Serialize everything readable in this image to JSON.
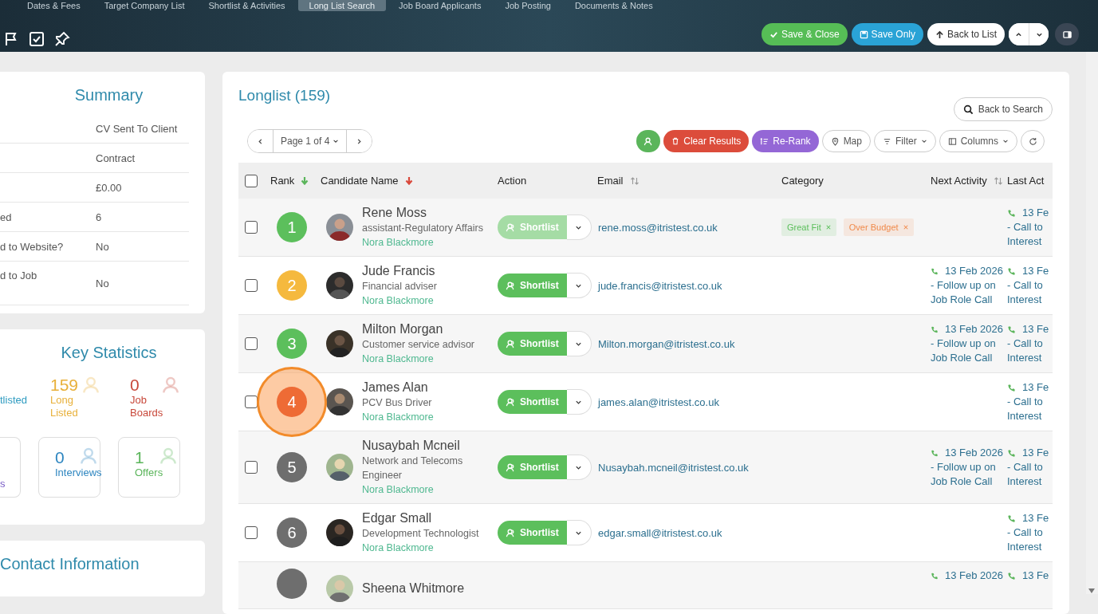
{
  "tabs": [
    {
      "label": "Dates & Fees",
      "selected": false
    },
    {
      "label": "Target Company List",
      "selected": false
    },
    {
      "label": "Shortlist & Activities",
      "selected": false
    },
    {
      "label": "Long List Search",
      "selected": true
    },
    {
      "label": "Job Board Applicants",
      "selected": false
    },
    {
      "label": "Job Posting",
      "selected": false
    },
    {
      "label": "Documents & Notes",
      "selected": false
    }
  ],
  "header_buttons": [
    {
      "kind": "save-close",
      "label": "Save & Close"
    },
    {
      "kind": "save",
      "label": "Save Only"
    },
    {
      "kind": "back",
      "label": "Back to List"
    }
  ],
  "summary": {
    "title": "Summary",
    "rows": [
      {
        "value": "CV Sent To Client"
      },
      {
        "value": "Contract"
      },
      {
        "value": "£0.00"
      },
      {
        "label": "ed",
        "value": "6"
      },
      {
        "label": "d to Website?",
        "value": "No"
      },
      {
        "label": "d to Job",
        "value": "No"
      }
    ]
  },
  "key_statistics": {
    "title": "Key Statistics",
    "items": [
      {
        "label": "tlisted",
        "color": "#2e9bc0",
        "boxed": false
      },
      {
        "number": "159",
        "label": "Long Listed",
        "color": "#e8b03a",
        "boxed": false
      },
      {
        "number": "0",
        "label": "Job Boards",
        "color": "#c8483a",
        "boxed": false
      },
      {
        "label": "s",
        "color": "#7b5fc7",
        "boxed": true
      },
      {
        "number": "0",
        "label": "Interviews",
        "color": "#2e86c0",
        "boxed": true
      },
      {
        "number": "1",
        "label": "Offers",
        "color": "#5bb55b",
        "boxed": true
      }
    ]
  },
  "contact": {
    "title": "Contact Information"
  },
  "longlist": {
    "title": "Longlist (159)",
    "back_to_search": "Back to Search",
    "page_label": "Page 1 of 4",
    "toolbar": [
      {
        "kind": "add"
      },
      {
        "kind": "clear",
        "label": "Clear Results"
      },
      {
        "kind": "rerank",
        "label": "Re-Rank"
      },
      {
        "kind": "map",
        "label": "Map"
      },
      {
        "kind": "filter",
        "label": "Filter"
      },
      {
        "kind": "columns",
        "label": "Columns"
      },
      {
        "kind": "refresh"
      }
    ],
    "select_all": {
      "checked": false
    },
    "columns": [
      {
        "label": "Rank",
        "sorted": true,
        "sortable": false,
        "color": "#5bb55b"
      },
      {
        "label": "Candidate Name",
        "sorted": true,
        "sortable": false,
        "color": "#d9483b"
      },
      {
        "label": "Action",
        "sorted": false,
        "sortable": false
      },
      {
        "label": "Email",
        "sorted": false,
        "sortable": true
      },
      {
        "label": "Category",
        "sorted": false,
        "sortable": false
      },
      {
        "label": "Next Activity",
        "sorted": false,
        "sortable": true
      },
      {
        "label": "Last Act",
        "sorted": false,
        "sortable": false
      }
    ],
    "rows": [
      {
        "checked": false,
        "rank": "1",
        "color": "#5cbf5c",
        "name": "Rene Moss",
        "role": "assistant-Regulatory Affairs",
        "owner": "Nora Blackmore",
        "action": "Shortlist",
        "disabled": true,
        "email": "rene.moss@itristest.co.uk",
        "tags": [
          {
            "label": "Great Fit",
            "color": "#5cbf5c"
          },
          {
            "label": "Over Budget",
            "color": "#f08a4b"
          }
        ],
        "last_activity": {
          "date": "13 Fe",
          "text": "- Call to",
          "text2": "Interest"
        }
      },
      {
        "checked": false,
        "rank": "2",
        "color": "#f5b93e",
        "name": "Jude Francis",
        "role": "Financial adviser",
        "owner": "Nora Blackmore",
        "action": "Shortlist",
        "disabled": false,
        "email": "jude.francis@itristest.co.uk",
        "next_activity": {
          "date": "13 Feb 2026",
          "text": "- Follow up on Job Role Call"
        },
        "last_activity": {
          "date": "13 Fe",
          "text": "- Call to",
          "text2": "Interest"
        }
      },
      {
        "checked": false,
        "rank": "3",
        "color": "#5cbf5c",
        "name": "Milton Morgan",
        "role": "Customer service advisor",
        "owner": "Nora Blackmore",
        "action": "Shortlist",
        "disabled": false,
        "email": "Milton.morgan@itristest.co.uk",
        "next_activity": {
          "date": "13 Feb 2026",
          "text": "- Follow up on Job Role Call"
        },
        "last_activity": {
          "date": "13 Fe",
          "text": "- Call to",
          "text2": "Interest"
        }
      },
      {
        "checked": false,
        "rank": "4",
        "color": "#ee6b35",
        "name": "James Alan",
        "role": "PCV Bus Driver",
        "owner": "Nora Blackmore",
        "action": "Shortlist",
        "disabled": false,
        "email": "james.alan@itristest.co.uk",
        "click_marker": true,
        "last_activity": {
          "date": "13 Fe",
          "text": "- Call to",
          "text2": "Interest"
        }
      },
      {
        "checked": false,
        "rank": "5",
        "color": "#6e6e6e",
        "name": "Nusaybah Mcneil",
        "role": "Network and Telecoms Engineer",
        "owner": "Nora Blackmore",
        "action": "Shortlist",
        "disabled": false,
        "email": "Nusaybah.mcneil@itristest.co.uk",
        "next_activity": {
          "date": "13 Feb 2026",
          "text": "- Follow up on Job Role Call"
        },
        "last_activity": {
          "date": "13 Fe",
          "text": "- Call to",
          "text2": "Interest"
        }
      },
      {
        "checked": false,
        "rank": "6",
        "color": "#6e6e6e",
        "name": "Edgar Small",
        "role": "Development Technologist",
        "owner": "Nora Blackmore",
        "action": "Shortlist",
        "disabled": false,
        "email": "edgar.small@itristest.co.uk",
        "last_activity": {
          "date": "13 Fe",
          "text": "- Call to",
          "text2": "Interest"
        }
      },
      {
        "rank": "",
        "color": "#6e6e6e",
        "name": "Sheena Whitmore",
        "partial": true,
        "next_activity": {
          "date": "13 Feb 2026"
        },
        "last_activity": {
          "date": "13 Fe"
        }
      }
    ]
  }
}
